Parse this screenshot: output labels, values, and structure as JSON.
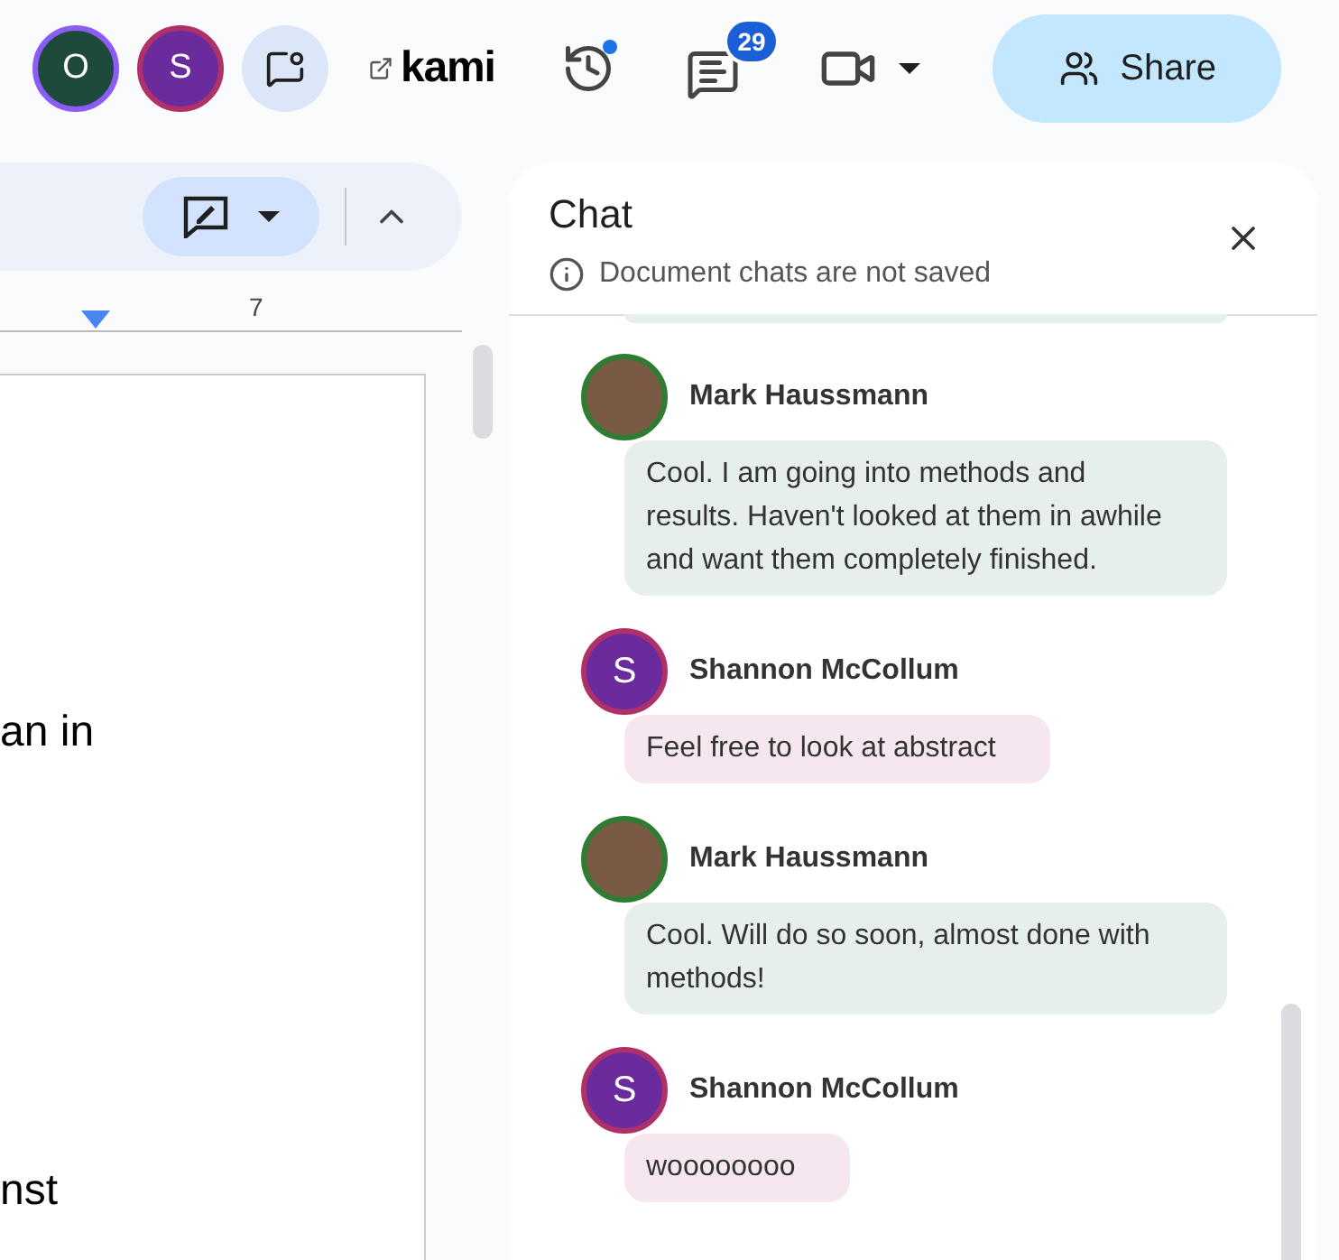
{
  "top_bar": {
    "avatars": [
      {
        "letter": "O",
        "color": "#1e4a3c"
      },
      {
        "letter": "S",
        "color": "#6a2c9c"
      }
    ],
    "app_name": "kami",
    "history_unread": true,
    "comments_badge": "29",
    "share_label": "Share"
  },
  "ruler": {
    "label": "7"
  },
  "document": {
    "lines": [
      "an in",
      "nst"
    ]
  },
  "chat": {
    "title": "Chat",
    "notice": "Document chats are not saved",
    "messages": [
      {
        "kind": "photo",
        "author": "Mark Haussmann",
        "text": "Cool. I am going into methods and results. Haven't looked at them in awhile and want them completely finished."
      },
      {
        "kind": "letter",
        "letter": "S",
        "author": "Shannon McCollum",
        "text": "Feel free to look at abstract"
      },
      {
        "kind": "photo",
        "author": "Mark Haussmann",
        "text": "Cool. Will do so soon, almost done with methods!"
      },
      {
        "kind": "letter",
        "letter": "S",
        "author": "Shannon McCollum",
        "text": "woooooooo"
      }
    ]
  }
}
